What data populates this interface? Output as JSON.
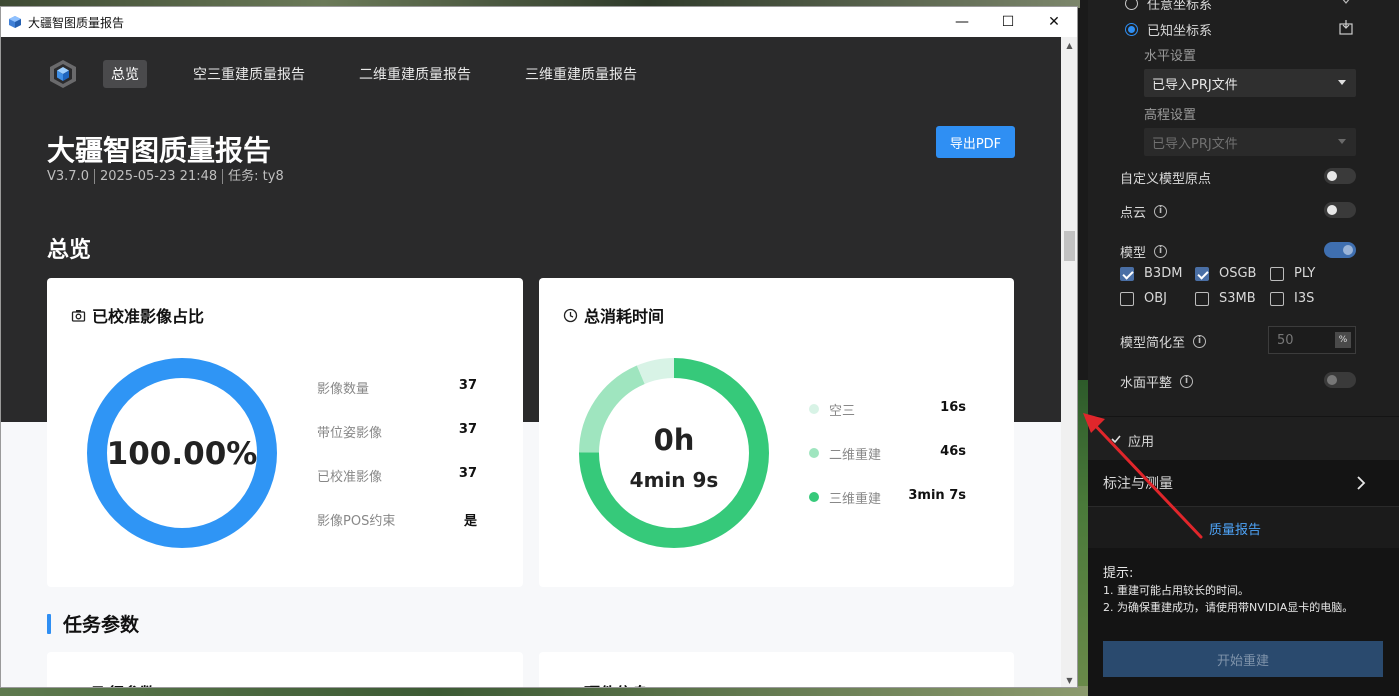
{
  "window": {
    "title": "大疆智图质量报告",
    "controls": {
      "minimize": "—",
      "maximize": "☐",
      "close": "✕"
    }
  },
  "nav": {
    "tabs": [
      {
        "label": "总览",
        "active": true
      },
      {
        "label": "空三重建质量报告",
        "active": false
      },
      {
        "label": "二维重建质量报告",
        "active": false
      },
      {
        "label": "三维重建质量报告",
        "active": false
      }
    ]
  },
  "header": {
    "title": "大疆智图质量报告",
    "version": "V3.7.0",
    "datetime": "2025-05-23 21:48",
    "task": "任务: ty8",
    "export_label": "导出PDF"
  },
  "overview": {
    "title": "总览",
    "calibrated_card": {
      "title": "已校准影像占比",
      "center_text": "100.00%",
      "ring_color": "#2f95f5",
      "stats": [
        {
          "label": "影像数量",
          "value": "37"
        },
        {
          "label": "带位姿影像",
          "value": "37"
        },
        {
          "label": "已校准影像",
          "value": "37"
        },
        {
          "label": "影像POS约束",
          "value": "是"
        }
      ]
    },
    "time_card": {
      "title": "总消耗时间",
      "center_line1": "0h",
      "center_line2": "4min 9s",
      "legend": [
        {
          "label": "空三",
          "value": "16s",
          "seconds": 16,
          "color": "#d8f3e6"
        },
        {
          "label": "二维重建",
          "value": "46s",
          "seconds": 46,
          "color": "#9fe5bf"
        },
        {
          "label": "三维重建",
          "value": "3min 7s",
          "seconds": 187,
          "color": "#36c97a"
        }
      ]
    }
  },
  "task_params": {
    "title": "任务参数",
    "flight_title": "飞行参数",
    "hardware_title": "硬件信息"
  },
  "panel": {
    "coord_unknown": "任意坐标系",
    "coord_known": "已知坐标系",
    "horizontal_label": "水平设置",
    "horizontal_value": "已导入PRJ文件",
    "elevation_label": "高程设置",
    "elevation_value": "已导入PRJ文件",
    "custom_origin": "自定义模型原点",
    "point_cloud": "点云",
    "model": "模型",
    "formats": [
      {
        "label": "B3DM",
        "checked": true
      },
      {
        "label": "OSGB",
        "checked": true
      },
      {
        "label": "PLY",
        "checked": false
      },
      {
        "label": "OBJ",
        "checked": false
      },
      {
        "label": "S3MB",
        "checked": false
      },
      {
        "label": "I3S",
        "checked": false
      }
    ],
    "simplify_label": "模型简化至",
    "simplify_value": "50",
    "simplify_unit": "%",
    "water_flatten": "水面平整",
    "apply": "应用",
    "annotate_measure": "标注与测量",
    "quality_report": "质量报告",
    "tips_title": "提示:",
    "tip1": "1. 重建可能占用较长的时间。",
    "tip2": "2. 为确保重建成功，请使用带NVIDIA显卡的电脑。",
    "start_button": "开始重建"
  },
  "colors": {
    "accent": "#2f8ff3",
    "hero_bg": "#2a2a2b",
    "panel_bg": "#1f1f1f",
    "annotation": "#e0262b"
  }
}
